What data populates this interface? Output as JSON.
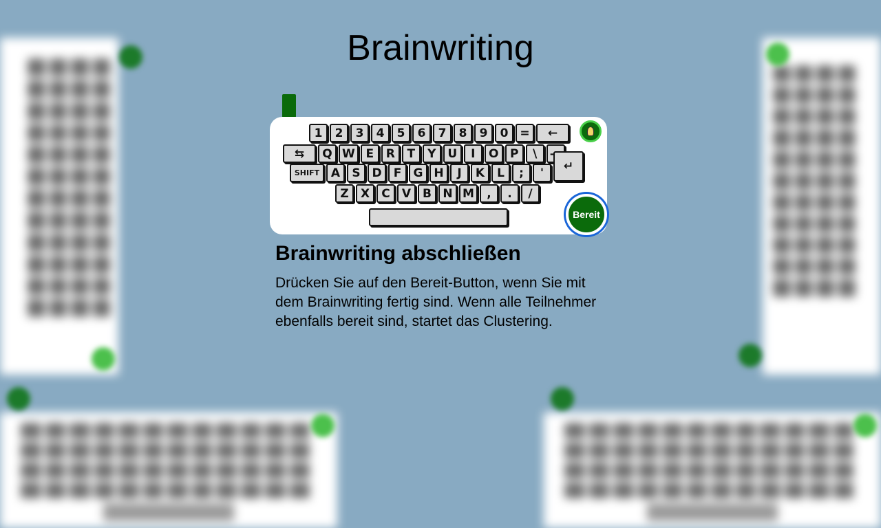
{
  "app": {
    "title": "Brainwriting"
  },
  "keyboard": {
    "row1": [
      "1",
      "2",
      "3",
      "4",
      "5",
      "6",
      "7",
      "8",
      "9",
      "0",
      "=",
      "←"
    ],
    "row2": [
      "⇆",
      "Q",
      "W",
      "E",
      "R",
      "T",
      "Y",
      "U",
      "I",
      "O",
      "P",
      "\\",
      "—"
    ],
    "row3": [
      "SHIFT",
      "A",
      "S",
      "D",
      "F",
      "G",
      "H",
      "J",
      "K",
      "L",
      ";",
      "'",
      "↵"
    ],
    "row4": [
      "Z",
      "X",
      "C",
      "V",
      "B",
      "N",
      "M",
      ",",
      ".",
      "/"
    ]
  },
  "ready_button": {
    "label": "Bereit"
  },
  "instructions": {
    "heading": "Brainwriting abschließen",
    "text": "Drücken Sie auf den Bereit-Button, wenn Sie mit dem Brainwriting fertig sind. Wenn alle Teilnehmer ebenfalls bereit sind, startet das Clustering."
  },
  "colors": {
    "background": "#88aac2",
    "ready_button": "#0b6b0b",
    "ready_ring": "#1a66d8",
    "marker": "#0a6a0a"
  },
  "icons": {
    "idea": "lightbulb-icon"
  }
}
